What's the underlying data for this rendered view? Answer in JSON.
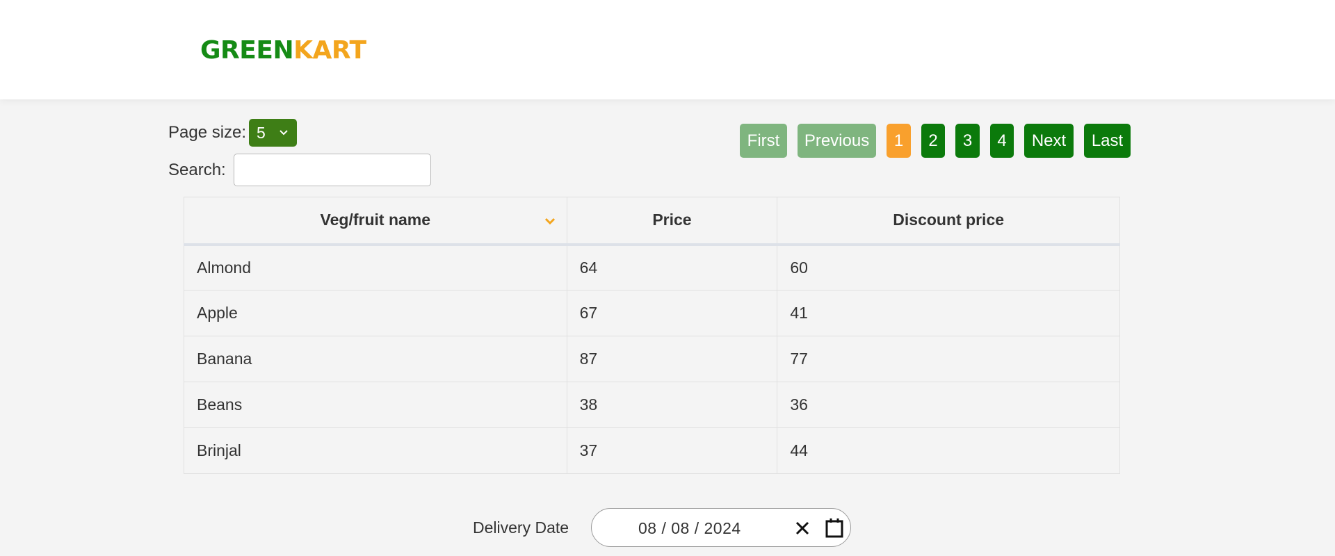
{
  "header": {
    "logo_part1": "GREEN",
    "logo_part2": "KART"
  },
  "controls": {
    "page_size_label": "Page size:",
    "page_size_value": "5",
    "search_label": "Search:",
    "search_value": "",
    "search_placeholder": ""
  },
  "pagination": {
    "first": "First",
    "previous": "Previous",
    "pages": [
      "1",
      "2",
      "3",
      "4"
    ],
    "active_page": "1",
    "next": "Next",
    "last": "Last"
  },
  "table": {
    "columns": [
      "Veg/fruit name",
      "Price",
      "Discount price"
    ],
    "rows": [
      [
        "Almond",
        "64",
        "60"
      ],
      [
        "Apple",
        "67",
        "41"
      ],
      [
        "Banana",
        "87",
        "77"
      ],
      [
        "Beans",
        "38",
        "36"
      ],
      [
        "Brinjal",
        "37",
        "44"
      ]
    ]
  },
  "delivery": {
    "label": "Delivery Date",
    "date": "08 / 08 / 2024"
  },
  "colors": {
    "brand_green": "#158b15",
    "brand_orange": "#f3a51d",
    "button_green": "#0b7a0b",
    "button_disabled": "#7fb57f",
    "active_page": "#f9a02d"
  }
}
